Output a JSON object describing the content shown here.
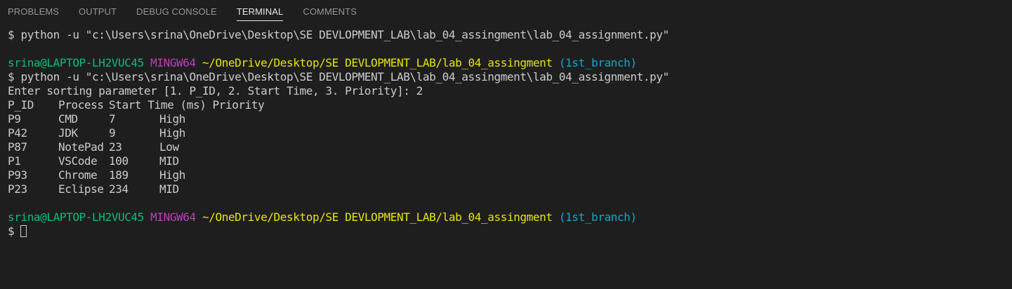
{
  "tabs": [
    {
      "label": "PROBLEMS"
    },
    {
      "label": "OUTPUT"
    },
    {
      "label": "DEBUG CONSOLE"
    },
    {
      "label": "TERMINAL"
    },
    {
      "label": "COMMENTS"
    }
  ],
  "active_tab": "TERMINAL",
  "terminal": {
    "cmd1": "$ python -u \"c:\\Users\\srina\\OneDrive\\Desktop\\SE DEVLOPMENT_LAB\\lab_04_assingment\\lab_04_assignment.py\"",
    "prompt": {
      "user_host": "srina@LAPTOP-LH2VUC45",
      "shell": "MINGW64",
      "path": "~/OneDrive/Desktop/SE DEVLOPMENT_LAB/lab_04_assingment",
      "branch": "(1st_branch)"
    },
    "cmd2": "$ python -u \"c:\\Users\\srina\\OneDrive\\Desktop\\SE DEVLOPMENT_LAB\\lab_04_assingment\\lab_04_assignment.py\"",
    "input_prompt": "Enter sorting parameter [1. P_ID, 2. Start Time, 3. Priority]: 2",
    "table_header": {
      "pid": "P_ID",
      "process": "Process",
      "start": "Start Time (ms)",
      "priority": "Priority"
    },
    "rows": [
      {
        "pid": "P9",
        "process": "CMD",
        "start": "7",
        "priority": "High"
      },
      {
        "pid": "P42",
        "process": "JDK",
        "start": "9",
        "priority": "High"
      },
      {
        "pid": "P87",
        "process": "NotePad",
        "start": "23",
        "priority": "Low"
      },
      {
        "pid": "P1",
        "process": "VSCode",
        "start": "100",
        "priority": "MID"
      },
      {
        "pid": "P93",
        "process": "Chrome",
        "start": "189",
        "priority": "High"
      },
      {
        "pid": "P23",
        "process": "Eclipse",
        "start": "234",
        "priority": "MID"
      }
    ],
    "final_prompt_symbol": "$"
  },
  "colors": {
    "background": "#1e1e1e",
    "text": "#cccccc",
    "user_host": "#0dbc79",
    "shell": "#bc3fbc",
    "path": "#e5e510",
    "branch": "#11a8cd"
  }
}
